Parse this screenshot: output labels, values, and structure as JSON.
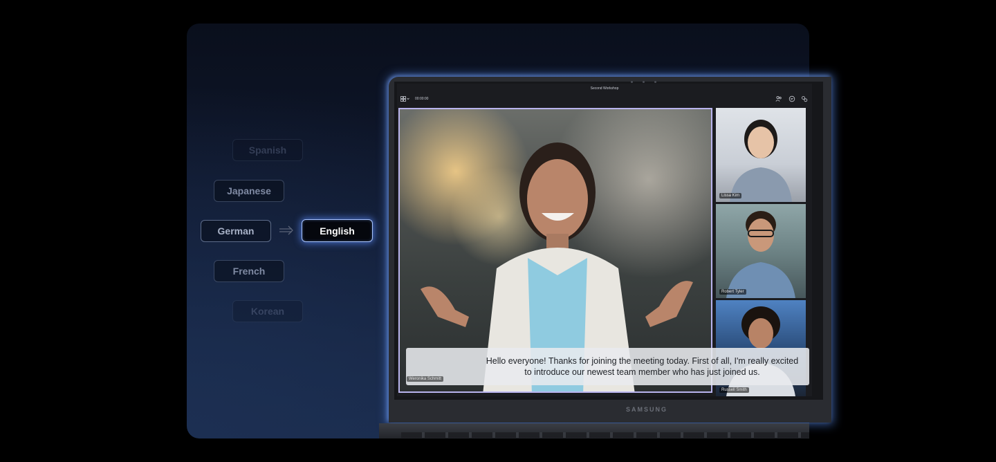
{
  "languages": {
    "sources": [
      "Spanish",
      "Japanese",
      "German",
      "French",
      "Korean"
    ],
    "target": "English"
  },
  "meeting": {
    "title": "Second Workshop",
    "timer": "00:00:00",
    "participants": [
      {
        "name": "Weronika Schmitt"
      },
      {
        "name": "Lissa Kim"
      },
      {
        "name": "Robert Tyler"
      },
      {
        "name": "Russell Smith"
      }
    ],
    "caption": "Hello everyone! Thanks for joining the meeting today. First of all, I'm really excited to introduce our newest team member who has just joined us."
  },
  "device": {
    "brand": "SAMSUNG"
  },
  "colors": {
    "accent_glow": "#5a8cff",
    "active_border": "#a9c4ff",
    "speaker_border": "#b9b4ee"
  }
}
